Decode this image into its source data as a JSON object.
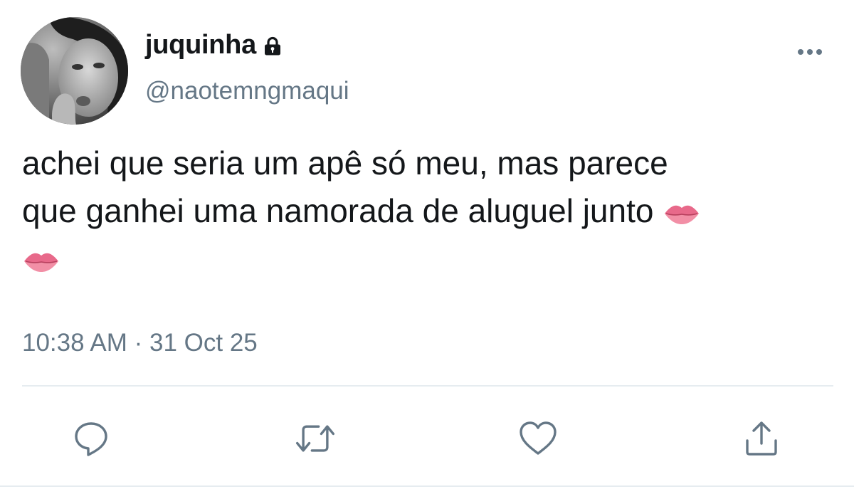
{
  "author": {
    "display_name": "juquinha",
    "handle": "@naotemngmaqui",
    "protected": true,
    "avatar": "grayscale-portrait-photo"
  },
  "tweet": {
    "text_line1": "achei que seria um apê só meu, mas parece",
    "text_line2": "que ganhei uma namorada de aluguel junto",
    "emojis": [
      "lips",
      "lips"
    ],
    "time": "10:38 AM",
    "separator": "·",
    "date": "31 Oct 25"
  },
  "actions": [
    "reply-icon",
    "retweet-icon",
    "like-icon",
    "share-icon"
  ],
  "colors": {
    "text": "#14171a",
    "secondary_text": "#657786",
    "icon": "#657786",
    "divider": "#e6ecf0",
    "background": "#ffffff"
  }
}
